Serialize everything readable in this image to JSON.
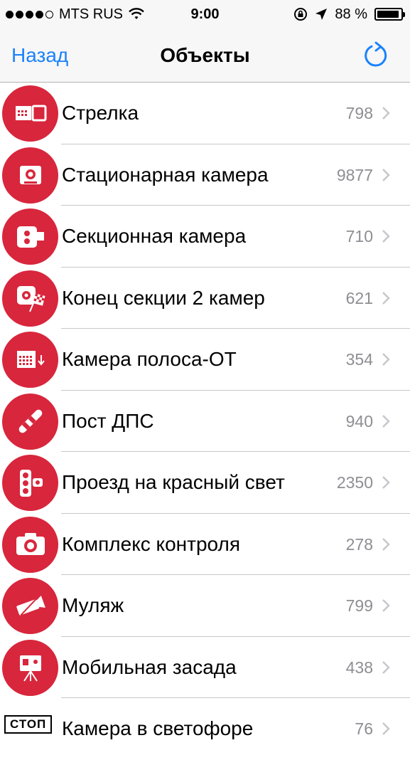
{
  "status_bar": {
    "carrier": "MTS RUS",
    "time": "9:00",
    "battery_percent": "88 %",
    "signal_bars_filled": 4,
    "icons": [
      "signal-dots-icon",
      "wifi-icon",
      "rotation-lock-icon",
      "location-arrow-icon",
      "battery-icon"
    ]
  },
  "nav": {
    "back_label": "Назад",
    "title": "Объекты",
    "refresh_icon": "refresh-icon"
  },
  "colors": {
    "accent": "#1a82fb",
    "icon_bg": "#d8263c",
    "count_text": "#8e8e93"
  },
  "items": [
    {
      "label": "Стрелка",
      "count": "798",
      "icon": "strelka-radar-icon"
    },
    {
      "label": "Стационарная камера",
      "count": "9877",
      "icon": "stationary-camera-icon"
    },
    {
      "label": "Секционная камера",
      "count": "710",
      "icon": "section-camera-icon"
    },
    {
      "label": "Конец секции 2 камер",
      "count": "621",
      "icon": "section-end-flag-icon"
    },
    {
      "label": "Камера полоса-ОТ",
      "count": "354",
      "icon": "lane-camera-icon"
    },
    {
      "label": "Пост ДПС",
      "count": "940",
      "icon": "police-baton-icon"
    },
    {
      "label": "Проезд на красный свет",
      "count": "2350",
      "icon": "traffic-light-icon"
    },
    {
      "label": "Комплекс контроля",
      "count": "278",
      "icon": "photo-camera-icon"
    },
    {
      "label": "Муляж",
      "count": "799",
      "icon": "dummy-camera-icon"
    },
    {
      "label": "Мобильная засада",
      "count": "438",
      "icon": "tripod-camera-icon"
    },
    {
      "label": "Камера в светофоре",
      "count": "76",
      "icon": "stop-sign-icon",
      "badge": "СТОП"
    }
  ]
}
